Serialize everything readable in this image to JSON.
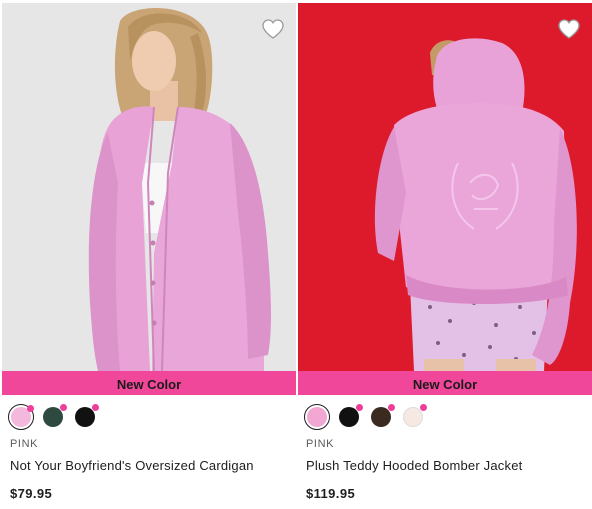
{
  "products": [
    {
      "banner": "New Color",
      "brand": "PINK",
      "title": "Not Your Boyfriend's Oversized Cardigan",
      "price": "$79.95",
      "image": "woman-in-pink-oversized-cardigan",
      "wishlist_icon": "heart-outline-icon",
      "swatches": [
        {
          "color": "#f4b8dc",
          "selected": true,
          "new": true
        },
        {
          "color": "#2e4a40",
          "selected": false,
          "new": true
        },
        {
          "color": "#111111",
          "selected": false,
          "new": true
        }
      ]
    },
    {
      "banner": "New Color",
      "brand": "PINK",
      "title": "Plush Teddy Hooded Bomber Jacket",
      "price": "$119.95",
      "image": "woman-in-pink-teddy-hooded-bomber-back-view",
      "wishlist_icon": "heart-outline-icon",
      "swatches": [
        {
          "color": "#f2a6d2",
          "selected": true,
          "new": false
        },
        {
          "color": "#111111",
          "selected": false,
          "new": true
        },
        {
          "color": "#3a2a20",
          "selected": false,
          "new": true
        },
        {
          "color": "#f6e8e2",
          "selected": false,
          "new": true
        }
      ]
    }
  ],
  "colors": {
    "banner": "#f0479a",
    "new_dot": "#ee3e9c",
    "photo_bg_1": "#e6e6e7",
    "photo_bg_2": "#dd1a2b",
    "garment_pink": "#eaa3d6"
  }
}
